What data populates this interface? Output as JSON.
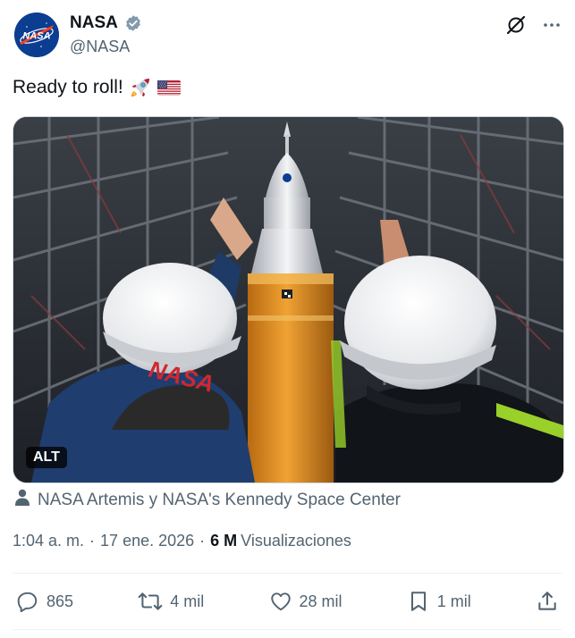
{
  "author": {
    "display_name": "NASA",
    "handle": "@NASA",
    "verified": true,
    "avatar_icon": "nasa-meatball-logo",
    "logo_text": "NASA"
  },
  "post": {
    "text": "Ready to roll!",
    "emojis": [
      "rocket",
      "us-flag"
    ]
  },
  "media": {
    "alt_badge": "ALT",
    "helmet_text": "NASA"
  },
  "tagged": {
    "icon": "person-icon",
    "text": "NASA Artemis y NASA's Kennedy Space Center"
  },
  "meta": {
    "time": "1:04 a. m.",
    "sep1": "·",
    "date": "17 ene. 2026",
    "sep2": "·",
    "views_count": "6 M",
    "views_label": "Visualizaciones"
  },
  "actions": {
    "replies": "865",
    "reposts": "4 mil",
    "likes": "28 mil",
    "bookmarks": "1 mil"
  },
  "colors": {
    "secondary_text": "#536471",
    "primary_text": "#0f1419",
    "verified_badge": "#829aab",
    "nasa_blue": "#0b3d91",
    "nasa_red": "#fc3d21"
  }
}
